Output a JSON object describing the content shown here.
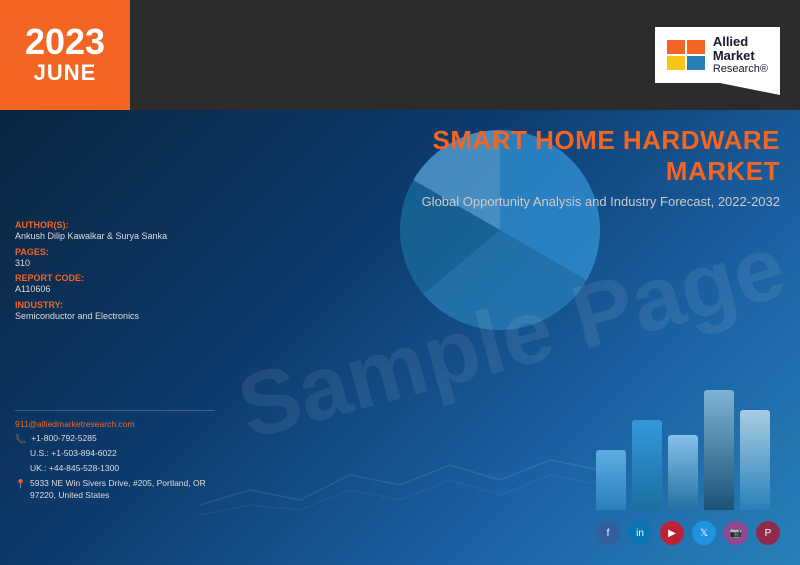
{
  "header": {
    "year": "2023",
    "month": "JUNE"
  },
  "logo": {
    "line1": "Allied",
    "line2": "Market",
    "line3": "Research®"
  },
  "title": {
    "main": "SMART HOME HARDWARE MARKET",
    "sub": "Global Opportunity Analysis and Industry Forecast, 2022-2032"
  },
  "watermark": "Sample Page",
  "info": {
    "authors_label": "AUTHOR(S):",
    "authors_value": "Ankush Dilip Kawalkar & Surya Sanka",
    "pages_label": "PAGES:",
    "pages_value": "310",
    "report_code_label": "REPORT CODE:",
    "report_code_value": "A110606",
    "industry_label": "INDUSTRY:",
    "industry_value": "Semiconductor and Electronics"
  },
  "contact": {
    "email": "911@alliedmarketresearch.com",
    "phone1": "+1-800-792-5285",
    "phone2": "U.S.: +1-503-894-6022",
    "phone3": "UK.: +44-845-528-1300",
    "address": "5933 NE Win Sivers Drive, #205, Portland, OR 97220, United States"
  },
  "social": {
    "icons": [
      "f",
      "in",
      "▶",
      "t",
      "📷",
      "p"
    ]
  },
  "chart": {
    "bars": [
      {
        "height": 60,
        "color": "#2980b9"
      },
      {
        "height": 90,
        "color": "#3498db"
      },
      {
        "height": 75,
        "color": "#1a6fa0"
      },
      {
        "height": 120,
        "color": "#5dade2"
      },
      {
        "height": 100,
        "color": "#2471a3"
      }
    ]
  },
  "colors": {
    "orange": "#f26522",
    "dark_bg": "#2c2c2c",
    "blue_bg": "#0d3b6e",
    "text_light": "#ddd",
    "text_dim": "#aaa"
  }
}
